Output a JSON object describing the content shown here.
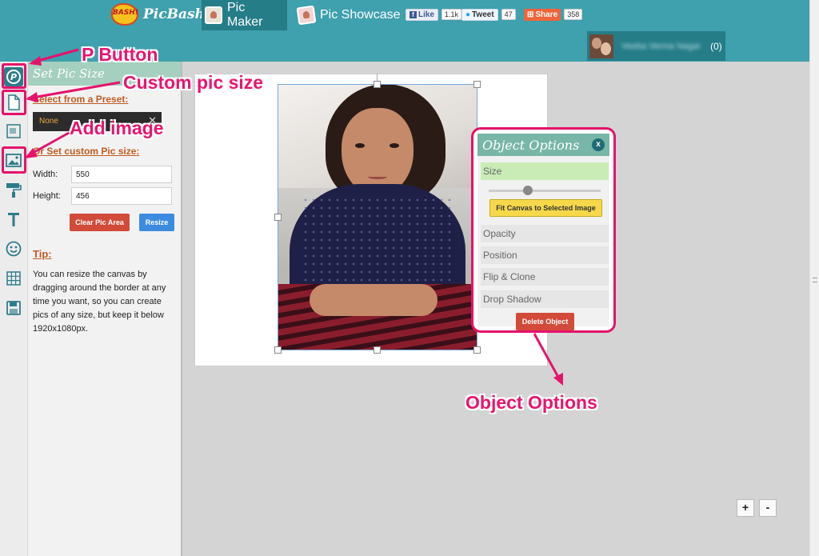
{
  "header": {
    "logo_burst": "BASH!",
    "logo_text": "PicBash",
    "nav": [
      {
        "label": "Pic Maker"
      },
      {
        "label": "Pic Showcase"
      }
    ],
    "social": {
      "fb_label": "Like",
      "fb_count": "1.1k",
      "tw_label": "Tweet",
      "tw_count": "47",
      "share_label": "Share",
      "share_count": "358"
    },
    "user": {
      "name": "Veeba Verma Nagar",
      "count": "(0)"
    }
  },
  "tools": [
    "p-button-icon",
    "page-icon",
    "gallery-icon",
    "image-icon",
    "paint-roller-icon",
    "text-icon",
    "smiley-icon",
    "grid-icon",
    "save-icon"
  ],
  "panel": {
    "title": "Set Pic Size",
    "preset_heading": "Select from a Preset:",
    "preset_value": "None",
    "custom_heading": "Or Set custom Pic size:",
    "width_label": "Width:",
    "width_value": "550",
    "height_label": "Height:",
    "height_value": "456",
    "clear_label": "Clear Pic Area",
    "resize_label": "Resize",
    "tip_heading": "Tip:",
    "tip_text": "You can resize the canvas by dragging around the border at any time you want, so you can create pics of any size, but keep it below 1920x1080px."
  },
  "object_options": {
    "title": "Object Options",
    "close": "x",
    "size_label": "Size",
    "size_value": 0.35,
    "fit_label": "Fit Canvas to Selected Image",
    "items": [
      "Opacity",
      "Position",
      "Flip & Clone",
      "Drop Shadow"
    ],
    "delete_label": "Delete Object"
  },
  "annotations": {
    "p_button": "P Button",
    "custom_size": "Custom pic size",
    "add_image": "Add image",
    "object_options": "Object Options"
  },
  "zoom": {
    "in": "+",
    "out": "-"
  },
  "colors": {
    "accent": "#3fa0ae",
    "highlight": "#e4136c",
    "danger": "#d24a3a",
    "primary": "#3d8be0"
  }
}
